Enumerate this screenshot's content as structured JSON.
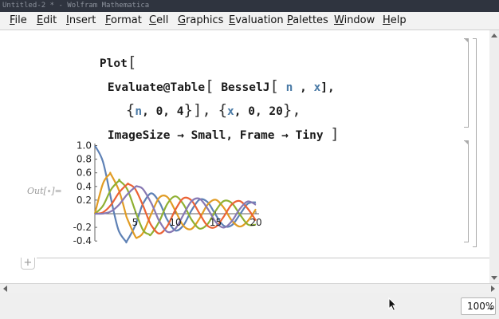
{
  "window": {
    "title": "Untitled-2 * - Wolfram Mathematica"
  },
  "menu": {
    "items": [
      {
        "label": "File",
        "mnemonic": "F",
        "rest": "ile"
      },
      {
        "label": "Edit",
        "mnemonic": "E",
        "rest": "dit"
      },
      {
        "label": "Insert",
        "mnemonic": "I",
        "rest": "nsert"
      },
      {
        "label": "Format",
        "mnemonic": "F",
        "rest": "ormat"
      },
      {
        "label": "Cell",
        "mnemonic": "C",
        "rest": "ell"
      },
      {
        "label": "Graphics",
        "mnemonic": "G",
        "rest": "raphics"
      },
      {
        "label": "Evaluation",
        "mnemonic": "E",
        "rest": "valuation"
      },
      {
        "label": "Palettes",
        "mnemonic": "P",
        "rest": "alettes"
      },
      {
        "label": "Window",
        "mnemonic": "W",
        "rest": "indow"
      },
      {
        "label": "Help",
        "mnemonic": "H",
        "rest": "elp"
      }
    ]
  },
  "input_cell": {
    "line1": {
      "fn": "Plot",
      "bracket": "["
    },
    "line2": {
      "head": "Evaluate@Table",
      "open": "[",
      "fn": "BesselJ",
      "open2": "[",
      "var1": "n",
      "comma": ",",
      "var2": "x",
      "close": "],",
      "spacer": " "
    },
    "line3": {
      "open": "{",
      "var": "n",
      "args": ", 0, 4",
      "close": "}],",
      "open2": "{",
      "var2": "x",
      "args2": ", 0, 20",
      "close2": "},",
      "spacer": " "
    },
    "line4": {
      "text": "ImageSize → Small, Frame → Tiny",
      "close": "]"
    }
  },
  "output_cell": {
    "label_prefix": "Out[",
    "label_dot": "∘",
    "label_suffix": "]="
  },
  "plot": {
    "colors": [
      "#5e81b5",
      "#e19c24",
      "#8fb032",
      "#eb6235",
      "#8778b3"
    ],
    "tick_x": [
      "5",
      "10",
      "15",
      "20"
    ],
    "tick_y": [
      "1.0",
      "0.8",
      "0.6",
      "0.4",
      "0.2",
      "-0.2",
      "-0.4"
    ]
  },
  "chart_data": {
    "type": "line",
    "title": "",
    "xlabel": "",
    "ylabel": "",
    "xlim": [
      0,
      20
    ],
    "ylim": [
      -0.45,
      1.05
    ],
    "x_ticks": [
      5,
      10,
      15,
      20
    ],
    "y_ticks": [
      1.0,
      0.8,
      0.6,
      0.4,
      0.2,
      -0.2,
      -0.4
    ],
    "function": "BesselJ[n, x]",
    "series": [
      {
        "n": 0,
        "values": [
          [
            0,
            1.0
          ],
          [
            1,
            0.765
          ],
          [
            2,
            0.224
          ],
          [
            2.405,
            0
          ],
          [
            3,
            -0.26
          ],
          [
            3.83,
            -0.403
          ],
          [
            4,
            -0.397
          ],
          [
            5,
            -0.178
          ],
          [
            5.52,
            0
          ],
          [
            6,
            0.151
          ],
          [
            7,
            0.3
          ],
          [
            8,
            0.172
          ],
          [
            8.65,
            0
          ],
          [
            9,
            -0.09
          ],
          [
            10,
            -0.246
          ],
          [
            11,
            -0.171
          ],
          [
            12,
            0.048
          ],
          [
            13,
            0.207
          ],
          [
            14,
            0.171
          ],
          [
            15,
            -0.014
          ],
          [
            16,
            -0.175
          ],
          [
            17,
            -0.17
          ],
          [
            18,
            -0.013
          ],
          [
            19,
            0.147
          ],
          [
            20,
            0.167
          ]
        ]
      },
      {
        "n": 1,
        "values": [
          [
            0,
            0
          ],
          [
            1,
            0.44
          ],
          [
            1.84,
            0.582
          ],
          [
            2,
            0.577
          ],
          [
            3,
            0.339
          ],
          [
            3.83,
            0
          ],
          [
            4,
            -0.066
          ],
          [
            5,
            -0.328
          ],
          [
            5.33,
            -0.346
          ],
          [
            6,
            -0.277
          ],
          [
            7,
            -0.005
          ],
          [
            8,
            0.235
          ],
          [
            9,
            0.245
          ],
          [
            10,
            0.043
          ],
          [
            11,
            -0.177
          ],
          [
            12,
            -0.223
          ],
          [
            13,
            -0.07
          ],
          [
            14,
            0.133
          ],
          [
            15,
            0.205
          ],
          [
            16,
            0.09
          ],
          [
            17,
            -0.098
          ],
          [
            18,
            -0.188
          ],
          [
            19,
            -0.106
          ],
          [
            20,
            0.067
          ]
        ]
      },
      {
        "n": 2,
        "values": [
          [
            0,
            0
          ],
          [
            1,
            0.115
          ],
          [
            2,
            0.353
          ],
          [
            3,
            0.486
          ],
          [
            3.05,
            0.486
          ],
          [
            4,
            0.364
          ],
          [
            5,
            0.047
          ],
          [
            5.14,
            0
          ],
          [
            6,
            -0.243
          ],
          [
            6.71,
            -0.301
          ],
          [
            7,
            -0.301
          ],
          [
            8,
            -0.113
          ],
          [
            9,
            0.145
          ],
          [
            10,
            0.255
          ],
          [
            11,
            0.139
          ],
          [
            12,
            -0.085
          ],
          [
            13,
            -0.218
          ],
          [
            14,
            -0.152
          ],
          [
            15,
            0.042
          ],
          [
            16,
            0.186
          ],
          [
            17,
            0.158
          ],
          [
            18,
            -0.008
          ],
          [
            19,
            -0.158
          ],
          [
            20,
            -0.16
          ]
        ]
      },
      {
        "n": 3,
        "values": [
          [
            0,
            0
          ],
          [
            1,
            0.02
          ],
          [
            2,
            0.129
          ],
          [
            3,
            0.309
          ],
          [
            4,
            0.43
          ],
          [
            4.2,
            0.434
          ],
          [
            5,
            0.365
          ],
          [
            6,
            0.115
          ],
          [
            6.38,
            0
          ],
          [
            7,
            -0.168
          ],
          [
            8,
            -0.291
          ],
          [
            9,
            -0.181
          ],
          [
            10,
            0.058
          ],
          [
            11,
            0.227
          ],
          [
            12,
            0.195
          ],
          [
            13,
            0.003
          ],
          [
            14,
            -0.177
          ],
          [
            15,
            -0.194
          ],
          [
            16,
            -0.044
          ],
          [
            17,
            0.135
          ],
          [
            18,
            0.186
          ],
          [
            19,
            0.073
          ],
          [
            20,
            -0.099
          ]
        ]
      },
      {
        "n": 4,
        "values": [
          [
            0,
            0
          ],
          [
            1,
            0.002
          ],
          [
            2,
            0.034
          ],
          [
            3,
            0.132
          ],
          [
            4,
            0.281
          ],
          [
            5,
            0.391
          ],
          [
            5.32,
            0.4
          ],
          [
            6,
            0.358
          ],
          [
            7,
            0.158
          ],
          [
            7.59,
            0
          ],
          [
            8,
            -0.105
          ],
          [
            9,
            -0.265
          ],
          [
            10,
            -0.22
          ],
          [
            11,
            -0.015
          ],
          [
            12,
            0.182
          ],
          [
            13,
            0.219
          ],
          [
            14,
            0.076
          ],
          [
            15,
            -0.119
          ],
          [
            16,
            -0.203
          ],
          [
            17,
            -0.111
          ],
          [
            18,
            0.07
          ],
          [
            19,
            0.181
          ],
          [
            20,
            0.131
          ]
        ]
      }
    ]
  }
}
